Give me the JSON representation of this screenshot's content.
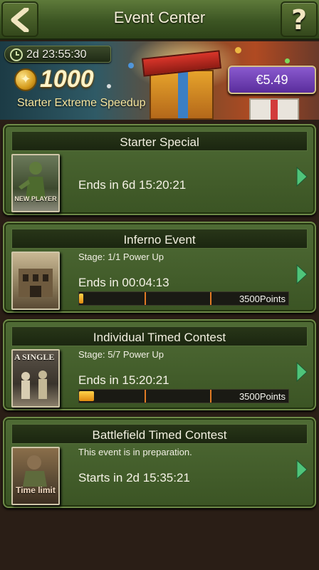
{
  "header": {
    "title": "Event Center",
    "help_label": "?"
  },
  "banner": {
    "timer": "2d 23:55:30",
    "amount": "1000",
    "label": "Starter Extreme Speedup",
    "price": "€5.49"
  },
  "events": [
    {
      "title": "Starter Special",
      "thumb_label": "NEW PLAYER",
      "status": "Ends in 6d 15:20:21"
    },
    {
      "title": "Inferno Event",
      "stage": "Stage: 1/1 Power Up",
      "status": "Ends in 00:04:13",
      "points": "3500Points",
      "progress": 0.02
    },
    {
      "title": "Individual Timed Contest",
      "thumb_title": "A SINGLE",
      "stage": "Stage: 5/7 Power Up",
      "status": "Ends in 15:20:21",
      "points": "3500Points",
      "progress": 0.07
    },
    {
      "title": "Battlefield Timed Contest",
      "thumb_label": "Time limit",
      "stage": "This event is in preparation.",
      "status": "Starts in 2d 15:35:21"
    }
  ]
}
